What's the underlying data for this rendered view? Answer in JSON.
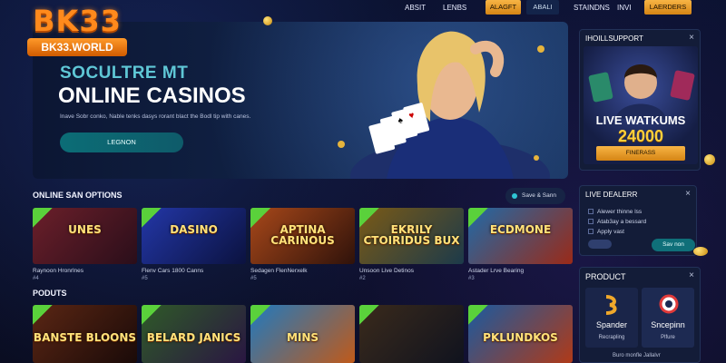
{
  "brand": {
    "logo": "BK33",
    "domain": "BK33.WORLD"
  },
  "nav": {
    "links": [
      "ABSIT",
      "LENBS",
      "STAINDNS",
      "INVI"
    ],
    "buttons": [
      "ALAGFT",
      "ABALI",
      "LAERDERS"
    ]
  },
  "hero": {
    "subtitle": "SOCULTRE MT",
    "title": "ONLINE CASINOS",
    "description": "Inave Sobr conko, Nable tenks dasys rorant blact the Bodl tip with canes.",
    "cta_label": "LEGNON"
  },
  "sections": {
    "options_title": "ONLINE SAN OPTIONS",
    "save_label": "Save & Sann",
    "products_title": "PODUTS"
  },
  "games_row1": [
    {
      "title": "UNES",
      "label": "Raynoon Hronrlnes",
      "sub": "#4",
      "colors": [
        "#6b1f2a",
        "#2a0e1a"
      ]
    },
    {
      "title": "DASINO",
      "label": "Flenv Cars 1800 Canns",
      "sub": "#5",
      "colors": [
        "#2337a8",
        "#0b123f"
      ]
    },
    {
      "title": "APTINA CARINOUS",
      "label": "Sedagen FlenNerxelk",
      "sub": "#5",
      "colors": [
        "#a8481a",
        "#2f120a"
      ]
    },
    {
      "title": "EKRILY CTOIRIDUS BUX",
      "label": "Unsoon Live Detinos",
      "sub": "#2",
      "colors": [
        "#7a5a16",
        "#1c3a4a"
      ]
    },
    {
      "title": "ECDMONE",
      "label": "Astader Lrve Bearing",
      "sub": "#3",
      "colors": [
        "#1f6aa8",
        "#9a2a18"
      ]
    }
  ],
  "games_row2": [
    {
      "title": "BANSTE BLOONS",
      "colors": [
        "#5a2614",
        "#1a0a08"
      ]
    },
    {
      "title": "BELARD JANICS",
      "colors": [
        "#2f5a28",
        "#2a1642"
      ]
    },
    {
      "title": "MINS",
      "colors": [
        "#1f7ac0",
        "#c05a1a"
      ]
    },
    {
      "title": "",
      "colors": [
        "#3a2a1c",
        "#10131e"
      ]
    },
    {
      "title": "PKLUNDKOS",
      "colors": [
        "#1a5aa0",
        "#b03a18"
      ]
    }
  ],
  "support": {
    "title": "IHOILLSUPPORT",
    "promo_line1": "LIVE WATKUMS",
    "promo_line2": "24000",
    "promo_btn": "FINERASS"
  },
  "live_dealer": {
    "title": "LIVE DEALERR",
    "options": [
      "Alewer thinne lss",
      "Atab3ay a bessard",
      "Apply vast"
    ],
    "btn": "Sav non"
  },
  "product": {
    "title": "PRODUCT",
    "tiles": [
      {
        "name": "Spander",
        "sub": "Recrapling"
      },
      {
        "name": "Sncepinn",
        "sub": "Plfure"
      }
    ],
    "footer": "Buro monfle Jallalvr"
  },
  "colors": {
    "accent_orange": "#f7b444",
    "teal": "#0f6f79",
    "background": "#0a0f24"
  }
}
